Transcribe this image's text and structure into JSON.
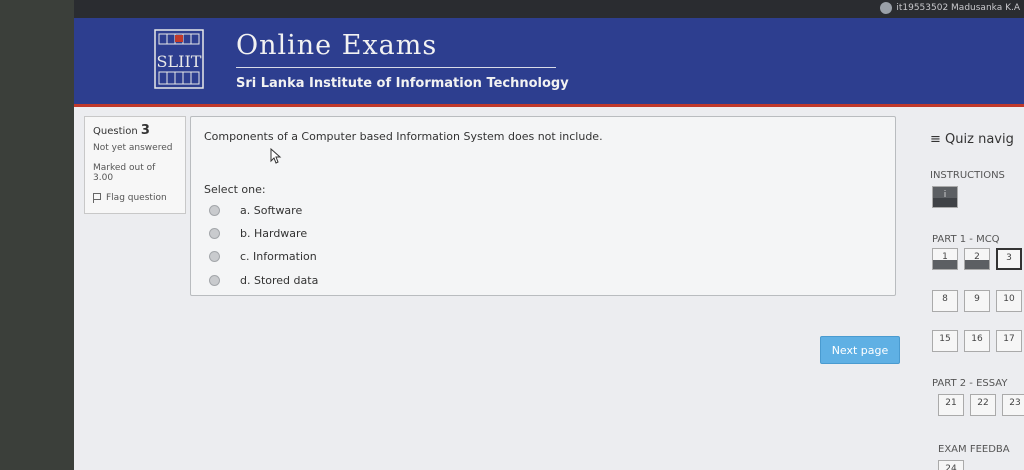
{
  "topbar": {
    "user_text": "it19553502 Madusanka K.A"
  },
  "header": {
    "logo_text": "SLIIT",
    "site_title": "Online Exams",
    "site_subtitle": "Sri Lanka Institute of Information Technology"
  },
  "question_info": {
    "question_label": "Question",
    "question_number": "3",
    "state": "Not yet answered",
    "marked_out_of": "Marked out of",
    "marks": "3.00",
    "flag_label": "Flag question"
  },
  "question": {
    "text": "Components of a Computer based Information System does not include.",
    "select_label": "Select one:",
    "options": [
      "a. Software",
      "b. Hardware",
      "c. Information",
      "d. Stored data"
    ]
  },
  "next_button": "Next page",
  "quiz_nav": {
    "title": "Quiz navig",
    "instructions_label": "INSTRUCTIONS",
    "instructions_btn": "i",
    "part1_label": "PART 1 - MCQ",
    "part1_row1": [
      "1",
      "2",
      "3"
    ],
    "part1_row2": [
      "8",
      "9",
      "10"
    ],
    "part1_row3": [
      "15",
      "16",
      "17"
    ],
    "part2_label": "PART 2 - ESSAY",
    "part2_row1": [
      "21",
      "22",
      "23"
    ],
    "exam_label": "EXAM FEEDBA",
    "exam_row1": [
      "24"
    ]
  }
}
